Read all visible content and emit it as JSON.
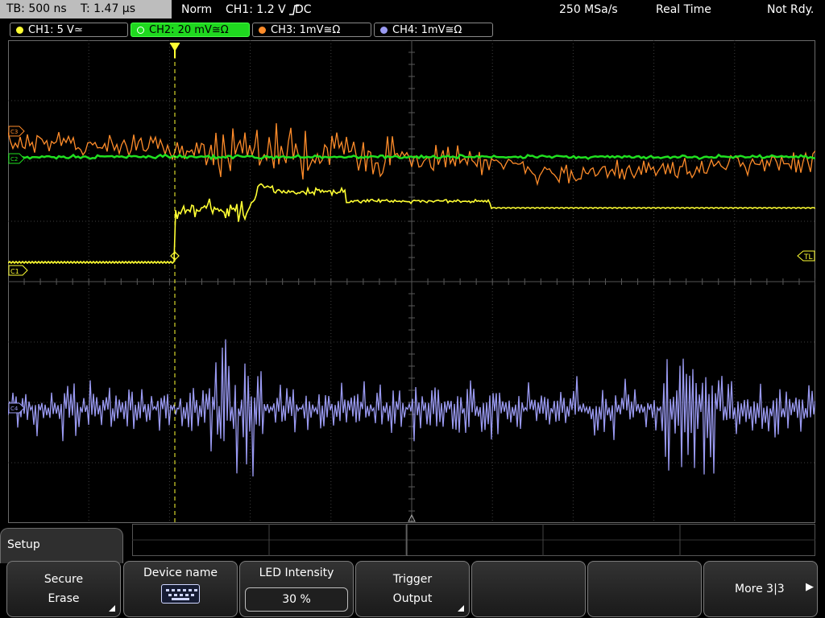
{
  "status": {
    "timebase": "TB: 500 ns",
    "trigger_time": "T: 1.47 µs",
    "mode": "Norm",
    "trigger_source": "CH1: 1.2 V",
    "trigger_coupling": "DC",
    "sample_rate": "250 MSa/s",
    "acq_mode": "Real Time",
    "run_state": "Not Rdy."
  },
  "channels": [
    {
      "label": "CH1: 5 V",
      "coupling_symbol": "≃",
      "color": "#ffff33",
      "active": false
    },
    {
      "label": "CH2: 20 mV",
      "coupling_symbol": "≅Ω",
      "color": "#20e020",
      "active": true
    },
    {
      "label": "CH3: 1mV",
      "coupling_symbol": "≅Ω",
      "color": "#ff8c2a",
      "active": false
    },
    {
      "label": "CH4: 1mV",
      "coupling_symbol": "≅Ω",
      "color": "#9a9af2",
      "active": false
    }
  ],
  "markers": {
    "ch1": "C1",
    "ch2": "C2",
    "ch3": "C3",
    "ch4": "C4",
    "trigger_level": "TL"
  },
  "menu": {
    "title": "Setup",
    "softkeys": [
      {
        "line1": "Secure",
        "line2": "Erase",
        "submenu": true
      },
      {
        "line1": "Device name",
        "icon": "keyboard-icon"
      },
      {
        "line1": "LED Intensity",
        "value": "30 %"
      },
      {
        "line1": "Trigger",
        "line2": "Output",
        "submenu": true
      },
      {
        "line1": ""
      },
      {
        "line1": ""
      },
      {
        "line1": "More 3|3",
        "arrow": "▶"
      }
    ]
  },
  "colors": {
    "grid": "#4a4a4a",
    "ch1": "#ffff33",
    "ch2": "#20e020",
    "ch3": "#ff8c2a",
    "ch4": "#9a9af2"
  }
}
